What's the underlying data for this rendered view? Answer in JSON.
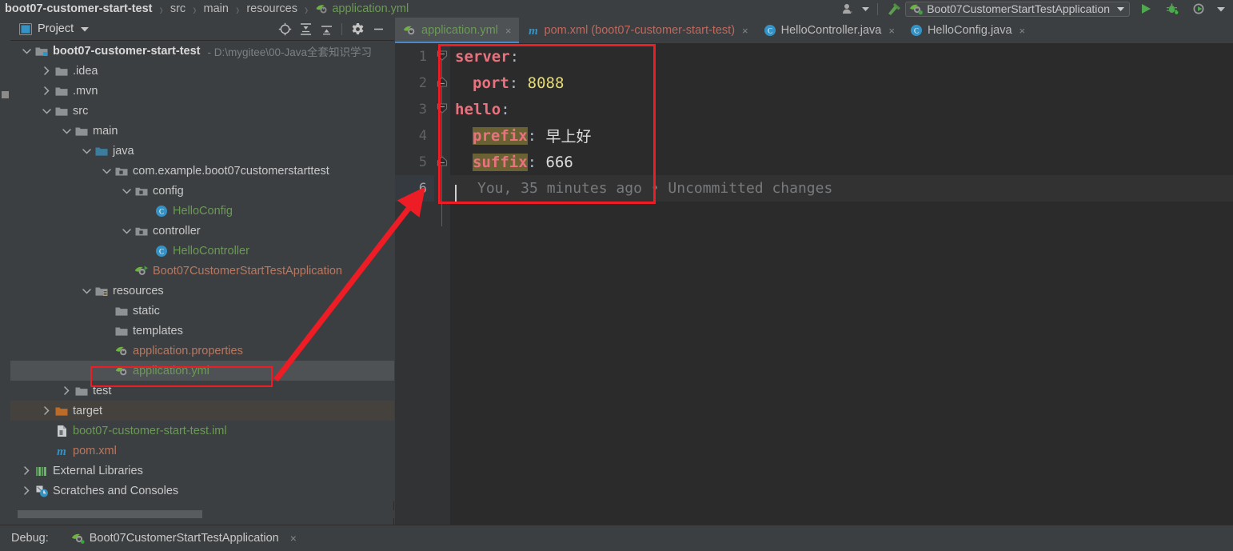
{
  "navbar": {
    "crumbs": [
      {
        "label": "boot07-customer-start-test",
        "style": "bold"
      },
      {
        "label": "src",
        "style": "plain"
      },
      {
        "label": "main",
        "style": "plain"
      },
      {
        "label": "resources",
        "style": "plain"
      },
      {
        "label": "application.yml",
        "style": "yml",
        "icon": "spring-yml-icon"
      }
    ],
    "separator": "›",
    "run_config": {
      "label": "Boot07CustomerStartTestApplication",
      "icon": "spring-boot-run-icon",
      "chevron": "▼"
    },
    "icons": {
      "account": "account-icon",
      "account_chevron": "▼",
      "build": "hammer-build-icon",
      "run": "run-icon",
      "debug": "debug-icon",
      "coverage": "run-with-coverage-icon",
      "more": "▼"
    }
  },
  "project_panel": {
    "title": "Project",
    "title_chevron": "▼",
    "toolbar_icons": [
      "select-opened-file-icon",
      "expand-all-icon",
      "collapse-all-icon",
      "settings-gear-icon",
      "hide-icon"
    ],
    "tree": [
      {
        "indent": 0,
        "twist": "down",
        "icon": "module-folder",
        "label": "boot07-customer-start-test",
        "style": "bold",
        "path": "- D:\\mygitee\\00-Java全套知识学习",
        "row": "normal"
      },
      {
        "indent": 1,
        "twist": "right",
        "icon": "folder",
        "label": ".idea",
        "style": "plain",
        "row": "normal"
      },
      {
        "indent": 1,
        "twist": "right",
        "icon": "folder",
        "label": ".mvn",
        "style": "plain",
        "row": "normal"
      },
      {
        "indent": 1,
        "twist": "down",
        "icon": "folder",
        "label": "src",
        "style": "plain",
        "row": "normal"
      },
      {
        "indent": 2,
        "twist": "down",
        "icon": "folder",
        "label": "main",
        "style": "plain",
        "row": "normal"
      },
      {
        "indent": 3,
        "twist": "down",
        "icon": "source-folder",
        "label": "java",
        "style": "plain",
        "row": "normal"
      },
      {
        "indent": 4,
        "twist": "down",
        "icon": "package",
        "label": "com.example.boot07customerstarttest",
        "style": "plain",
        "row": "normal"
      },
      {
        "indent": 5,
        "twist": "down",
        "icon": "package",
        "label": "config",
        "style": "plain",
        "row": "normal"
      },
      {
        "indent": 6,
        "twist": "none",
        "icon": "java-class",
        "label": "HelloConfig",
        "style": "green",
        "row": "normal"
      },
      {
        "indent": 5,
        "twist": "down",
        "icon": "package",
        "label": "controller",
        "style": "plain",
        "row": "normal"
      },
      {
        "indent": 6,
        "twist": "none",
        "icon": "java-class",
        "label": "HelloController",
        "style": "green",
        "row": "normal"
      },
      {
        "indent": 5,
        "twist": "none",
        "icon": "spring-boot-class",
        "label": "Boot07CustomerStartTestApplication",
        "style": "orange",
        "row": "normal"
      },
      {
        "indent": 3,
        "twist": "down",
        "icon": "resource-folder",
        "label": "resources",
        "style": "plain",
        "row": "normal"
      },
      {
        "indent": 4,
        "twist": "none",
        "icon": "folder",
        "label": "static",
        "style": "plain",
        "row": "normal"
      },
      {
        "indent": 4,
        "twist": "none",
        "icon": "folder",
        "label": "templates",
        "style": "plain",
        "row": "normal"
      },
      {
        "indent": 4,
        "twist": "none",
        "icon": "spring-props-icon",
        "label": "application.properties",
        "style": "orange",
        "row": "normal"
      },
      {
        "indent": 4,
        "twist": "none",
        "icon": "spring-yml-icon",
        "label": "application.yml",
        "style": "green",
        "row": "selected"
      },
      {
        "indent": 2,
        "twist": "right",
        "icon": "folder",
        "label": "test",
        "style": "plain",
        "row": "normal"
      },
      {
        "indent": 1,
        "twist": "right",
        "icon": "excluded-folder",
        "label": "target",
        "style": "plain",
        "row": "highlight"
      },
      {
        "indent": 1,
        "twist": "none",
        "icon": "iml-file",
        "label": "boot07-customer-start-test.iml",
        "style": "green",
        "row": "normal"
      },
      {
        "indent": 1,
        "twist": "none",
        "icon": "maven-icon",
        "label": "pom.xml",
        "style": "orange",
        "row": "normal"
      },
      {
        "indent": 0,
        "twist": "right",
        "icon": "libraries-icon",
        "label": "External Libraries",
        "style": "plain",
        "row": "normal"
      },
      {
        "indent": 0,
        "twist": "right",
        "icon": "scratches-icon",
        "label": "Scratches and Consoles",
        "style": "plain",
        "row": "normal"
      }
    ]
  },
  "editor": {
    "tabs": [
      {
        "label": "application.yml",
        "icon": "spring-yml-icon",
        "style": "green",
        "active": true,
        "close": "×"
      },
      {
        "label": "pom.xml (boot07-customer-start-test)",
        "icon": "maven-icon",
        "style": "red",
        "active": false,
        "close": "×"
      },
      {
        "label": "HelloController.java",
        "icon": "java-class",
        "style": "grey",
        "active": false,
        "close": "×"
      },
      {
        "label": "HelloConfig.java",
        "icon": "java-class",
        "style": "grey",
        "active": false,
        "close": "×"
      }
    ],
    "lines": [
      {
        "num": "1",
        "indent": 0,
        "fold": "open",
        "key": "server",
        "key_hl": false,
        "colon": ":",
        "value": "",
        "value_type": "none"
      },
      {
        "num": "2",
        "indent": 1,
        "fold": "end",
        "key": "port",
        "key_hl": false,
        "colon": ":",
        "value": "8088",
        "value_type": "num"
      },
      {
        "num": "3",
        "indent": 0,
        "fold": "open",
        "key": "hello",
        "key_hl": false,
        "colon": ":",
        "value": "",
        "value_type": "none"
      },
      {
        "num": "4",
        "indent": 1,
        "fold": "none",
        "key": "prefix",
        "key_hl": true,
        "colon": ":",
        "value": "早上好",
        "value_type": "text"
      },
      {
        "num": "5",
        "indent": 1,
        "fold": "end",
        "key": "suffix",
        "key_hl": true,
        "colon": ":",
        "value": "666",
        "value_type": "text"
      },
      {
        "num": "6",
        "indent": 1,
        "fold": "none",
        "key": "",
        "key_hl": false,
        "colon": "",
        "value": "",
        "value_type": "blame",
        "blame": "You, 35 minutes ago • Uncommitted changes"
      }
    ]
  },
  "bottom_bar": {
    "label": "Debug:",
    "session": "Boot07CustomerStartTestApplication",
    "session_icon": "spring-boot-run-icon",
    "close": "×"
  },
  "annotations": {
    "accent_color": "#ee1c25",
    "code_box": "highlights the yaml configuration block",
    "tree_box": "highlights application.yml file node",
    "arrow": "points from application.yml tree node to the editor content"
  },
  "colors": {
    "window_bg": "#3c3f41",
    "editor_bg": "#2b2b2b",
    "gutter_bg": "#313335",
    "selection": "#4e5254",
    "tab_underline": "#4a88c7",
    "yaml_key": "#e8737f",
    "yaml_number": "#e6db74",
    "yaml_identifier_highlight": "#6b6233",
    "green_file": "#6a9a54",
    "orange_file": "#b87861",
    "annotation_red": "#ee1c25"
  }
}
